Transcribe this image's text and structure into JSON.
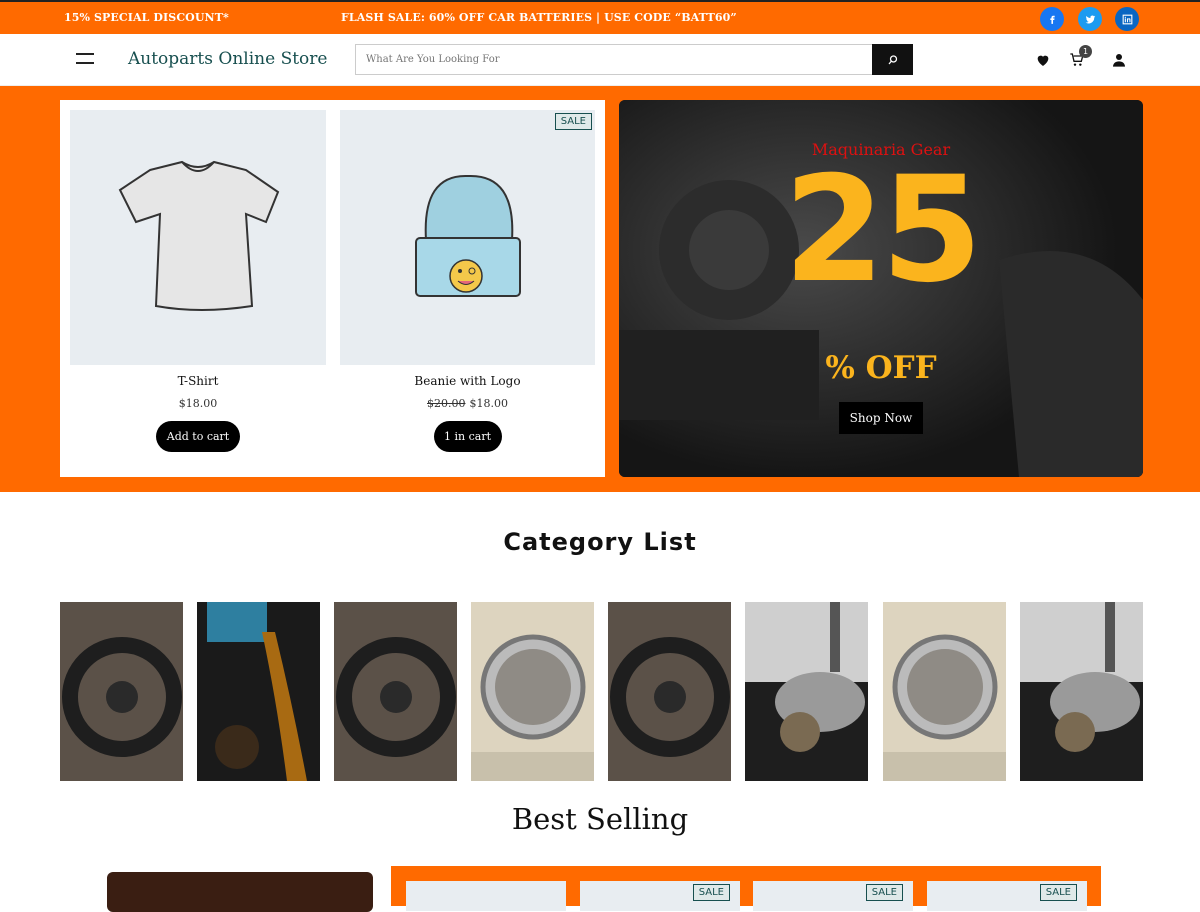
{
  "topbar": {
    "promo_left": "15% SPECIAL DISCOUNT*",
    "promo_mid": "FLASH SALE: 60% OFF CAR BATTERIES | USE CODE “BATT60”",
    "social": [
      "facebook-icon",
      "twitter-icon",
      "linkedin-icon"
    ],
    "accent_color": "#ff6a00"
  },
  "header": {
    "brand": "Autoparts Online Store",
    "search_placeholder": "What Are You Looking For",
    "cart_count": "1"
  },
  "hero": {
    "products": [
      {
        "name": "T-Shirt",
        "price": "$18.00",
        "old_price": "",
        "button": "Add to cart",
        "sale": ""
      },
      {
        "name": "Beanie with Logo",
        "price": "$18.00",
        "old_price": "$20.00",
        "button": "1 in cart",
        "sale": "SALE"
      }
    ],
    "banner": {
      "subtitle": "Maquinaria Gear",
      "number": "25",
      "off": "% OFF",
      "button": "Shop Now"
    }
  },
  "categories": {
    "title": "Category List",
    "tiles": [
      "steering-wheel",
      "oil-pour",
      "steering-wheel",
      "headlight",
      "steering-wheel",
      "tire",
      "headlight",
      "tire"
    ]
  },
  "best_selling": {
    "title": "Best Selling",
    "sale_badges": [
      "SALE",
      "SALE",
      "SALE"
    ]
  }
}
